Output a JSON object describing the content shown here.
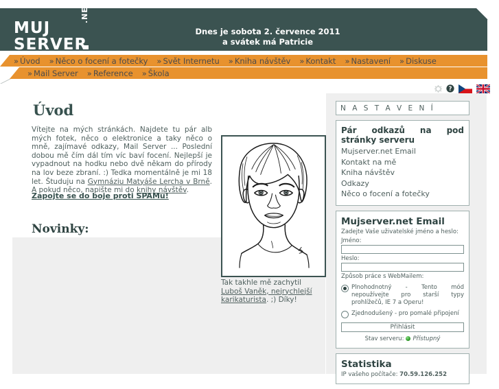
{
  "header": {
    "logo_line1": "MUJ",
    "logo_line2": "SERVER",
    "logo_suffix": ".NET",
    "date_line1": "Dnes je sobota 2. července 2011",
    "date_line2": "a svátek má Patricie"
  },
  "nav": {
    "chevron": "»",
    "row1": [
      {
        "label": "Úvod"
      },
      {
        "label": "Něco o focení a fotečky"
      },
      {
        "label": "Svět Internetu"
      },
      {
        "label": "Kniha návštěv"
      },
      {
        "label": "Kontakt"
      },
      {
        "label": "Nastavení"
      },
      {
        "label": "Diskuse"
      }
    ],
    "row2": [
      {
        "label": "Mail Server"
      },
      {
        "label": "Reference"
      },
      {
        "label": "Škola"
      }
    ]
  },
  "iconbar": {
    "gear": "gear-icon",
    "help": "help-icon",
    "flag_cz": "czech-flag-icon",
    "flag_uk": "uk-flag-icon"
  },
  "main": {
    "title": "Úvod",
    "intro_part1": "Vítejte na mých stránkách. Najdete tu pár alb mých fotek, něco o elektronice a taky něco o mně, zajímavé odkazy, Mail Server ... Poslední dobou mě čím dál tím víc baví focení. Nejlepší je vypadnout na hodku nebo dvě někam do přírody na lov beze zbraní. :) Tedka momentálně je mi 18 let. Študuju na ",
    "intro_link1": "Gymnáziu Matyáše Lercha v Brně",
    "intro_part2": ". A pokud něco, napište mi do ",
    "intro_link2": "knihy návštěv",
    "intro_part3": ".",
    "spam_link": "Zapojte se do boje proti SPAMu!",
    "novinky_title": "Novinky:",
    "caption_part1": "Tak takhle mě zachytil ",
    "caption_link": "Luboš Vaněk, nejrychlejší karikaturista",
    "caption_part2": ". ;) Díky!",
    "portrait_alt": "caricature-portrait"
  },
  "sidebar": {
    "settings_header": "N A S T A V E N Í",
    "links_panel": {
      "heading": "Pár odkazů na pod stránky serveru",
      "items": [
        {
          "label": "Mujserver.net Email"
        },
        {
          "label": "Kontakt na mě"
        },
        {
          "label": "Kniha návštěv"
        },
        {
          "label": "Odkazy"
        },
        {
          "label": "Něco o focení a fotečky"
        }
      ]
    },
    "email_panel": {
      "heading": "Mujserver.net Email",
      "instruction": "Zadejte Vaše uživatelské jméno a heslo:",
      "name_label": "Jméno:",
      "name_value": "",
      "password_label": "Heslo:",
      "password_value": "",
      "mode_label": "Způsob práce s WebMailem:",
      "mode_option_full": "Plnohodnotný - Tento mód nepoužívejte pro starší typy prohlížečů, IE 7 a Operu!",
      "mode_option_simple": "Zjednodušený - pro pomalé připojení",
      "mode_selected": "full",
      "submit_label": "Přihlásit",
      "server_state_label": "Stav serveru:",
      "server_state_value": "Přístupný",
      "server_state_color": "#35a32f"
    },
    "stats_panel": {
      "heading": "Statistika",
      "ip_label": "IP vašeho počítače: ",
      "ip_value": "70.59.126.252"
    }
  },
  "colors": {
    "banner": "#3b5351",
    "nav": "#e8922e",
    "page_bg": "#efefef",
    "text": "#4e5f5d"
  }
}
